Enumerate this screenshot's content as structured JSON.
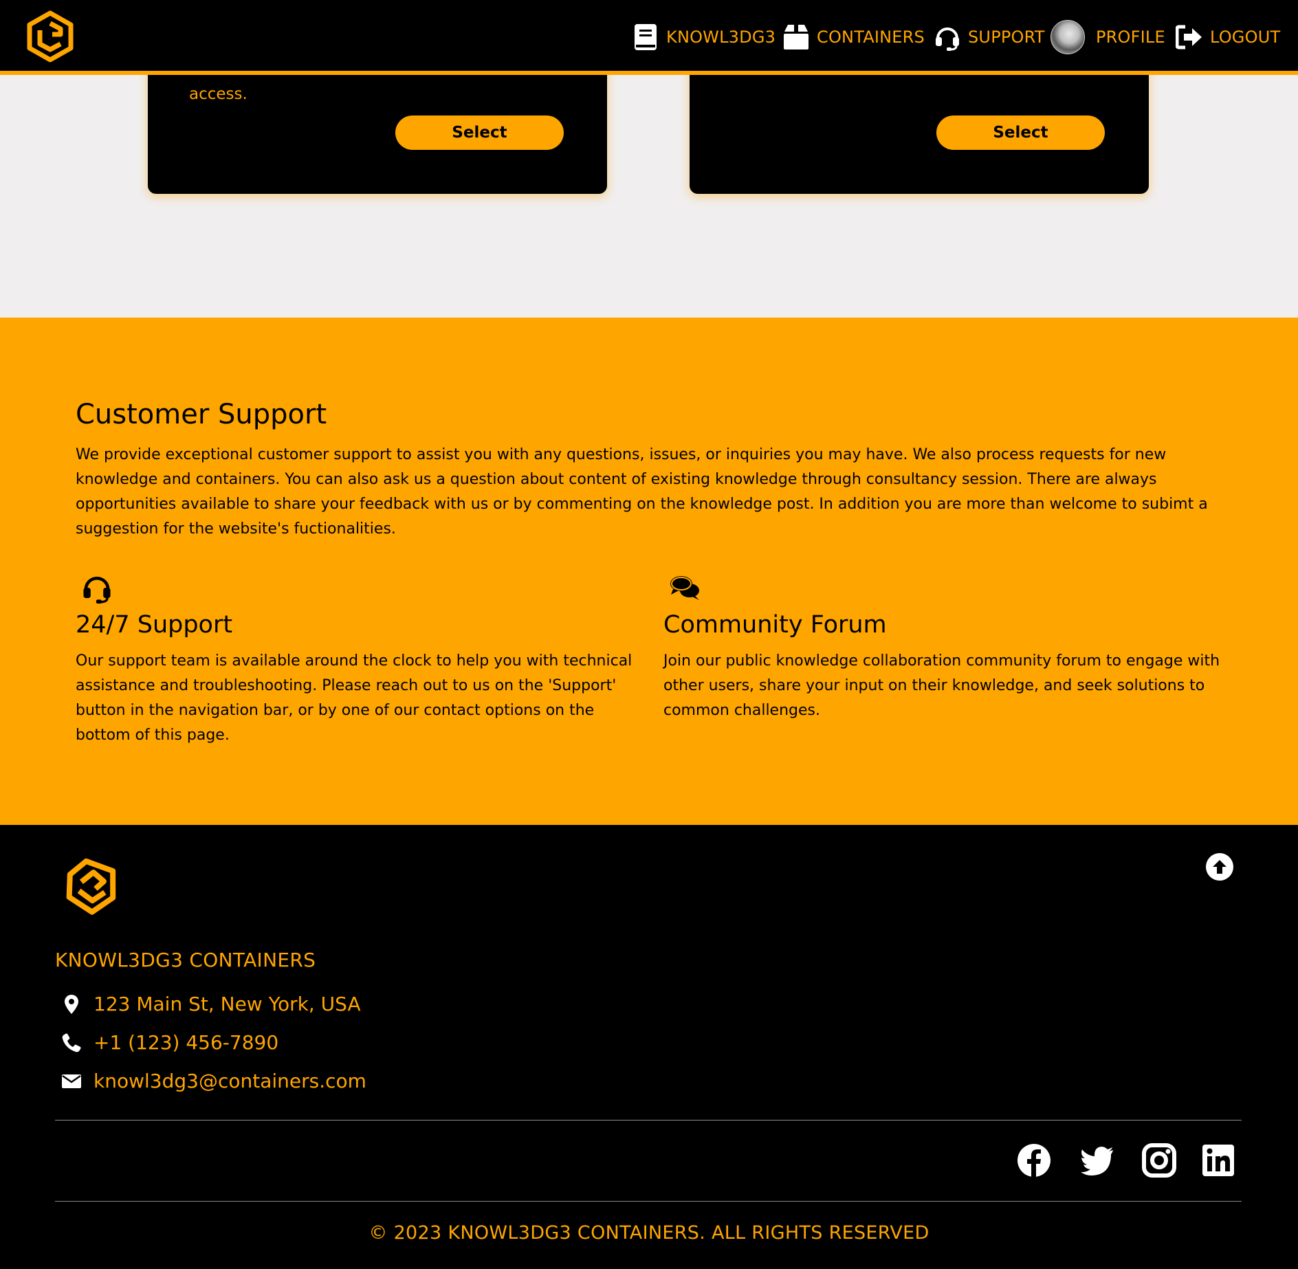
{
  "nav": {
    "items": [
      {
        "label": "KNOWL3DG3"
      },
      {
        "label": "CONTAINERS"
      },
      {
        "label": "SUPPORT"
      },
      {
        "label": "PROFILE"
      },
      {
        "label": "LOGOUT"
      }
    ]
  },
  "plans": {
    "left_fragment": "access.",
    "select_label": "Select"
  },
  "support": {
    "title": "Customer Support",
    "intro": "We provide exceptional customer support to assist you with any questions, issues, or inquiries you may have. We also process requests for new knowledge and containers. You can also ask us a question about content of existing knowledge through consultancy session. There are always opportunities available to share your feedback with us or by commenting on the knowledge post. In addition you are more than welcome to subimt a suggestion for the website's fuctionalities.",
    "features": [
      {
        "icon": "headset-icon",
        "title": "24/7 Support",
        "text": "Our support team is available around the clock to help you with technical assistance and troubleshooting. Please reach out to us on the 'Support' button in the navigation bar, or by one of our contact options on the bottom of this page."
      },
      {
        "icon": "comments-icon",
        "title": "Community Forum",
        "text": "Join our public knowledge collaboration community forum to engage with other users, share your input on their knowledge, and seek solutions to common challenges."
      }
    ]
  },
  "footer": {
    "company": "KNOWL3DG3 CONTAINERS",
    "address": "123 Main St, New York, USA",
    "phone": "+1 (123) 456-7890",
    "email": "knowl3dg3@containers.com",
    "social": [
      "facebook-icon",
      "twitter-icon",
      "instagram-icon",
      "linkedin-icon"
    ],
    "copyright": "© 2023 KNOWL3DG3 CONTAINERS. ALL RIGHTS RESERVED"
  },
  "colors": {
    "accent": "#ffa500",
    "background": "#f0eeee",
    "dark": "#000000"
  }
}
